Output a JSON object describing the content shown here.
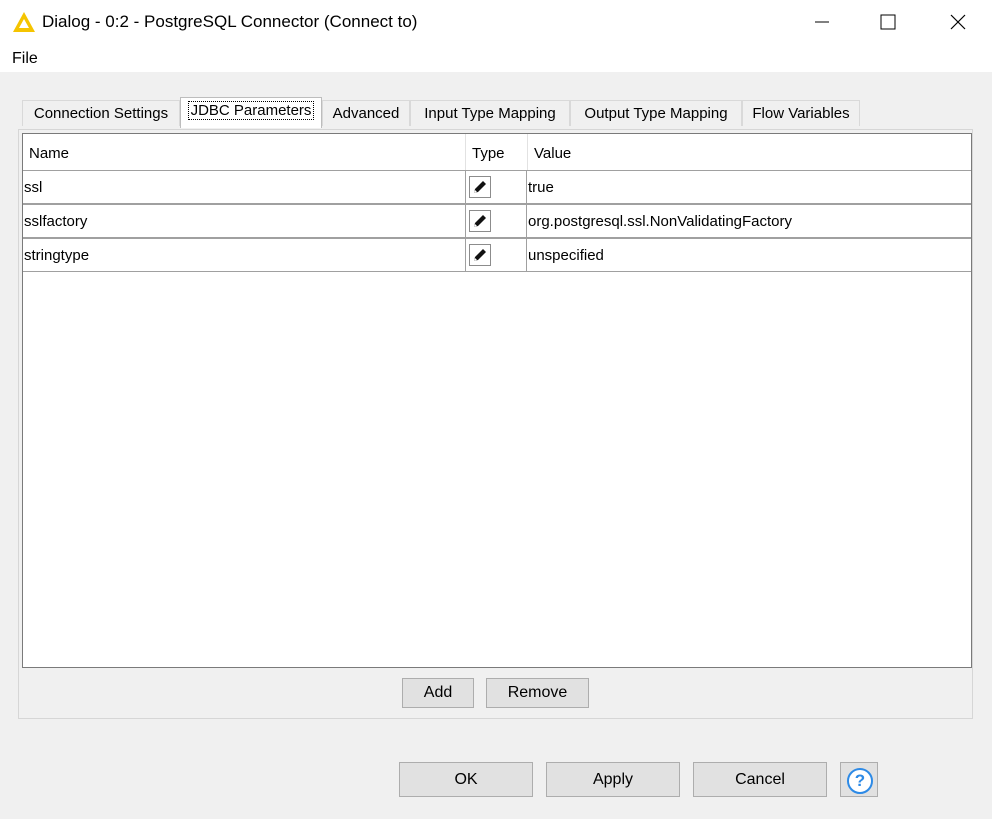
{
  "window": {
    "title": "Dialog - 0:2 - PostgreSQL Connector (Connect to)",
    "icon": "knime-warning-triangle-icon",
    "controls": [
      "minimize-icon",
      "maximize-icon",
      "close-icon"
    ]
  },
  "menu": {
    "file": "File"
  },
  "tabs": [
    {
      "label": "Connection Settings",
      "active": false
    },
    {
      "label": "JDBC Parameters",
      "active": true
    },
    {
      "label": "Advanced",
      "active": false
    },
    {
      "label": "Input Type Mapping",
      "active": false
    },
    {
      "label": "Output Type Mapping",
      "active": false
    },
    {
      "label": "Flow Variables",
      "active": false
    }
  ],
  "table": {
    "columns": [
      "Name",
      "Type",
      "Value"
    ],
    "rows": [
      {
        "name": "ssl",
        "type_icon": "pencil-icon",
        "value": "true"
      },
      {
        "name": "sslfactory",
        "type_icon": "pencil-icon",
        "value": "org.postgresql.ssl.NonValidatingFactory"
      },
      {
        "name": "stringtype",
        "type_icon": "pencil-icon",
        "value": "unspecified"
      }
    ]
  },
  "table_buttons": {
    "add": "Add",
    "remove": "Remove"
  },
  "footer": {
    "ok": "OK",
    "apply": "Apply",
    "cancel": "Cancel",
    "help_icon": "help-icon"
  },
  "colors": {
    "accent": "#2d8ae6",
    "icon_yellow": "#f5c400"
  }
}
